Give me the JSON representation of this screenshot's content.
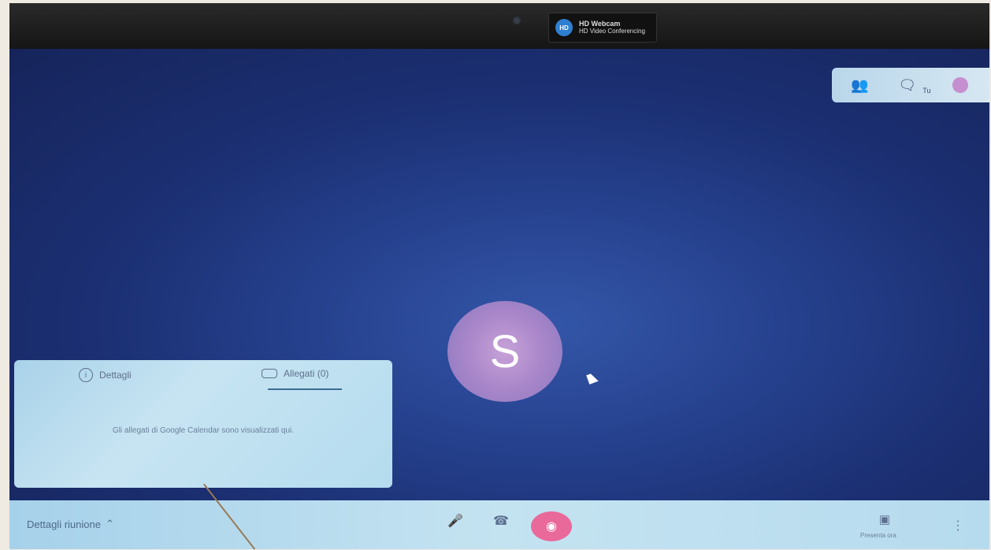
{
  "webcam": {
    "badge_brand": "HD Webcam",
    "badge_sub": "HD Video Conferencing",
    "badge_icon": "hd-camera-icon"
  },
  "top_panel": {
    "people_icon": "people-icon",
    "chat_icon": "chat-icon",
    "you_label": "Tu"
  },
  "participant": {
    "initial": "S"
  },
  "details_card": {
    "tab_details": "Dettagli",
    "tab_attachments": "Allegati (0)",
    "message": "Gli allegati di Google Calendar sono visualizzati qui."
  },
  "bottom_bar": {
    "meeting_details": "Dettagli riunione",
    "present_label": "Presenta ora"
  },
  "colors": {
    "screen_bg": "#1b2f72",
    "avatar": "#a986c9",
    "hangup": "#e9699a",
    "panel": "#c4e3f1"
  }
}
